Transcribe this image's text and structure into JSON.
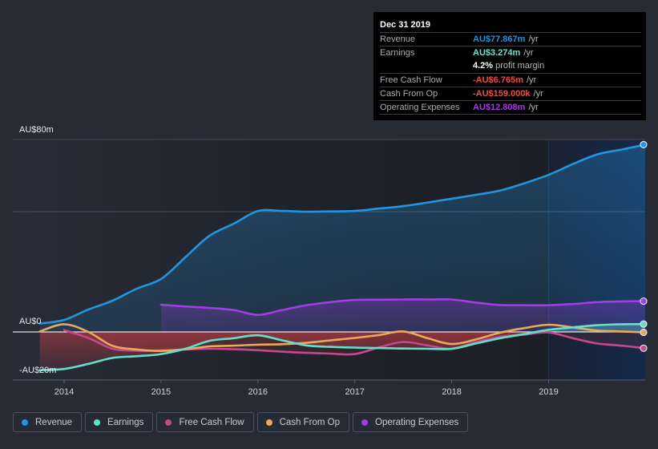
{
  "tooltip": {
    "date": "Dec 31 2019",
    "rows": [
      {
        "label": "Revenue",
        "value": "AU$77.867m",
        "unit": "/yr",
        "color": "#2394df"
      },
      {
        "label": "Earnings",
        "value": "AU$3.274m",
        "unit": "/yr",
        "color": "#6ee3cf"
      },
      {
        "label": "Free Cash Flow",
        "value": "-AU$6.765m",
        "unit": "/yr",
        "color": "#ef4a4a"
      },
      {
        "label": "Cash From Op",
        "value": "-AU$159.000k",
        "unit": "/yr",
        "color": "#ef4a4a"
      },
      {
        "label": "Operating Expenses",
        "value": "AU$12.808m",
        "unit": "/yr",
        "color": "#a13ce6"
      }
    ],
    "profit_margin": {
      "value": "4.2%",
      "label": "profit margin"
    }
  },
  "legend": [
    {
      "label": "Revenue",
      "color": "#2394df"
    },
    {
      "label": "Earnings",
      "color": "#63e0cb"
    },
    {
      "label": "Free Cash Flow",
      "color": "#c4488b"
    },
    {
      "label": "Cash From Op",
      "color": "#e9a95c"
    },
    {
      "label": "Operating Expenses",
      "color": "#a13ce6"
    }
  ],
  "chart_data": {
    "type": "line",
    "title": "",
    "xlabel": "",
    "ylabel": "",
    "y_axis_labels": {
      "top": "AU$80m",
      "zero": "AU$0",
      "bottom": "-AU$20m"
    },
    "ylim": [
      -20,
      80
    ],
    "y_gridlines": [
      80,
      50
    ],
    "xlim": [
      2013.75,
      2020.0
    ],
    "x_ticks": [
      {
        "label": "2014",
        "value": 2014
      },
      {
        "label": "2015",
        "value": 2015
      },
      {
        "label": "2016",
        "value": 2016
      },
      {
        "label": "2017",
        "value": 2017
      },
      {
        "label": "2018",
        "value": 2018
      },
      {
        "label": "2019",
        "value": 2019
      }
    ],
    "highlight_range": [
      2019.0,
      2020.0
    ],
    "units": "AU$ millions",
    "x": [
      2013.75,
      2014.0,
      2014.25,
      2014.5,
      2014.75,
      2015.0,
      2015.25,
      2015.5,
      2015.75,
      2016.0,
      2016.25,
      2016.5,
      2016.75,
      2017.0,
      2017.25,
      2017.5,
      2017.75,
      2018.0,
      2018.25,
      2018.5,
      2018.75,
      2019.0,
      2019.25,
      2019.5,
      2019.75,
      2020.0
    ],
    "series": [
      {
        "name": "Revenue",
        "key": "revenue",
        "color": "#2394df",
        "fill": true,
        "values": [
          3.5,
          5.0,
          9.3,
          13.0,
          18.0,
          22.0,
          31.0,
          40.0,
          45.0,
          50.3,
          50.3,
          50.0,
          50.1,
          50.3,
          51.3,
          52.3,
          53.8,
          55.4,
          57.0,
          58.8,
          61.8,
          65.3,
          69.8,
          73.8,
          75.8,
          77.867
        ]
      },
      {
        "name": "Operating Expenses",
        "key": "opex",
        "color": "#a13ce6",
        "fill": true,
        "values": [
          null,
          null,
          null,
          null,
          null,
          11.3,
          10.6,
          10.0,
          9.1,
          7.1,
          9.1,
          11.1,
          12.4,
          13.3,
          13.4,
          13.5,
          13.5,
          13.5,
          12.2,
          11.2,
          11.1,
          11.1,
          11.6,
          12.4,
          12.7,
          12.808
        ]
      },
      {
        "name": "Earnings",
        "key": "earnings",
        "color": "#63e0cb",
        "fill": true,
        "values": [
          -15.9,
          -15.4,
          -13.3,
          -10.8,
          -10.1,
          -9.2,
          -7.0,
          -3.7,
          -2.6,
          -1.4,
          -3.5,
          -5.6,
          -6.2,
          -6.5,
          -6.7,
          -6.9,
          -7.0,
          -7.0,
          -4.8,
          -2.6,
          -0.9,
          0.9,
          1.9,
          2.8,
          3.2,
          3.274
        ]
      },
      {
        "name": "Cash From Op",
        "key": "cfo",
        "color": "#e9a95c",
        "fill": false,
        "values": [
          0.2,
          3.2,
          0.0,
          -5.8,
          -7.3,
          -7.9,
          -7.2,
          -6.0,
          -5.7,
          -5.3,
          -5.1,
          -4.5,
          -3.5,
          -2.5,
          -1.3,
          0.2,
          -2.6,
          -5.0,
          -3.1,
          -0.3,
          1.6,
          3.0,
          1.9,
          0.6,
          0.2,
          -0.159
        ]
      },
      {
        "name": "Free Cash Flow",
        "key": "fcf",
        "color": "#c4488b",
        "fill": false,
        "values": [
          null,
          0.8,
          -2.5,
          -7.0,
          -7.8,
          -7.7,
          -7.3,
          -7.0,
          -7.2,
          -7.6,
          -8.2,
          -8.7,
          -9.0,
          -9.2,
          -6.4,
          -4.2,
          -5.6,
          -7.0,
          -4.2,
          -2.0,
          -1.1,
          -0.2,
          -2.6,
          -4.8,
          -5.7,
          -6.765
        ]
      }
    ],
    "negative_fill_color": "#d6404a",
    "legend_position": "bottom-left"
  }
}
